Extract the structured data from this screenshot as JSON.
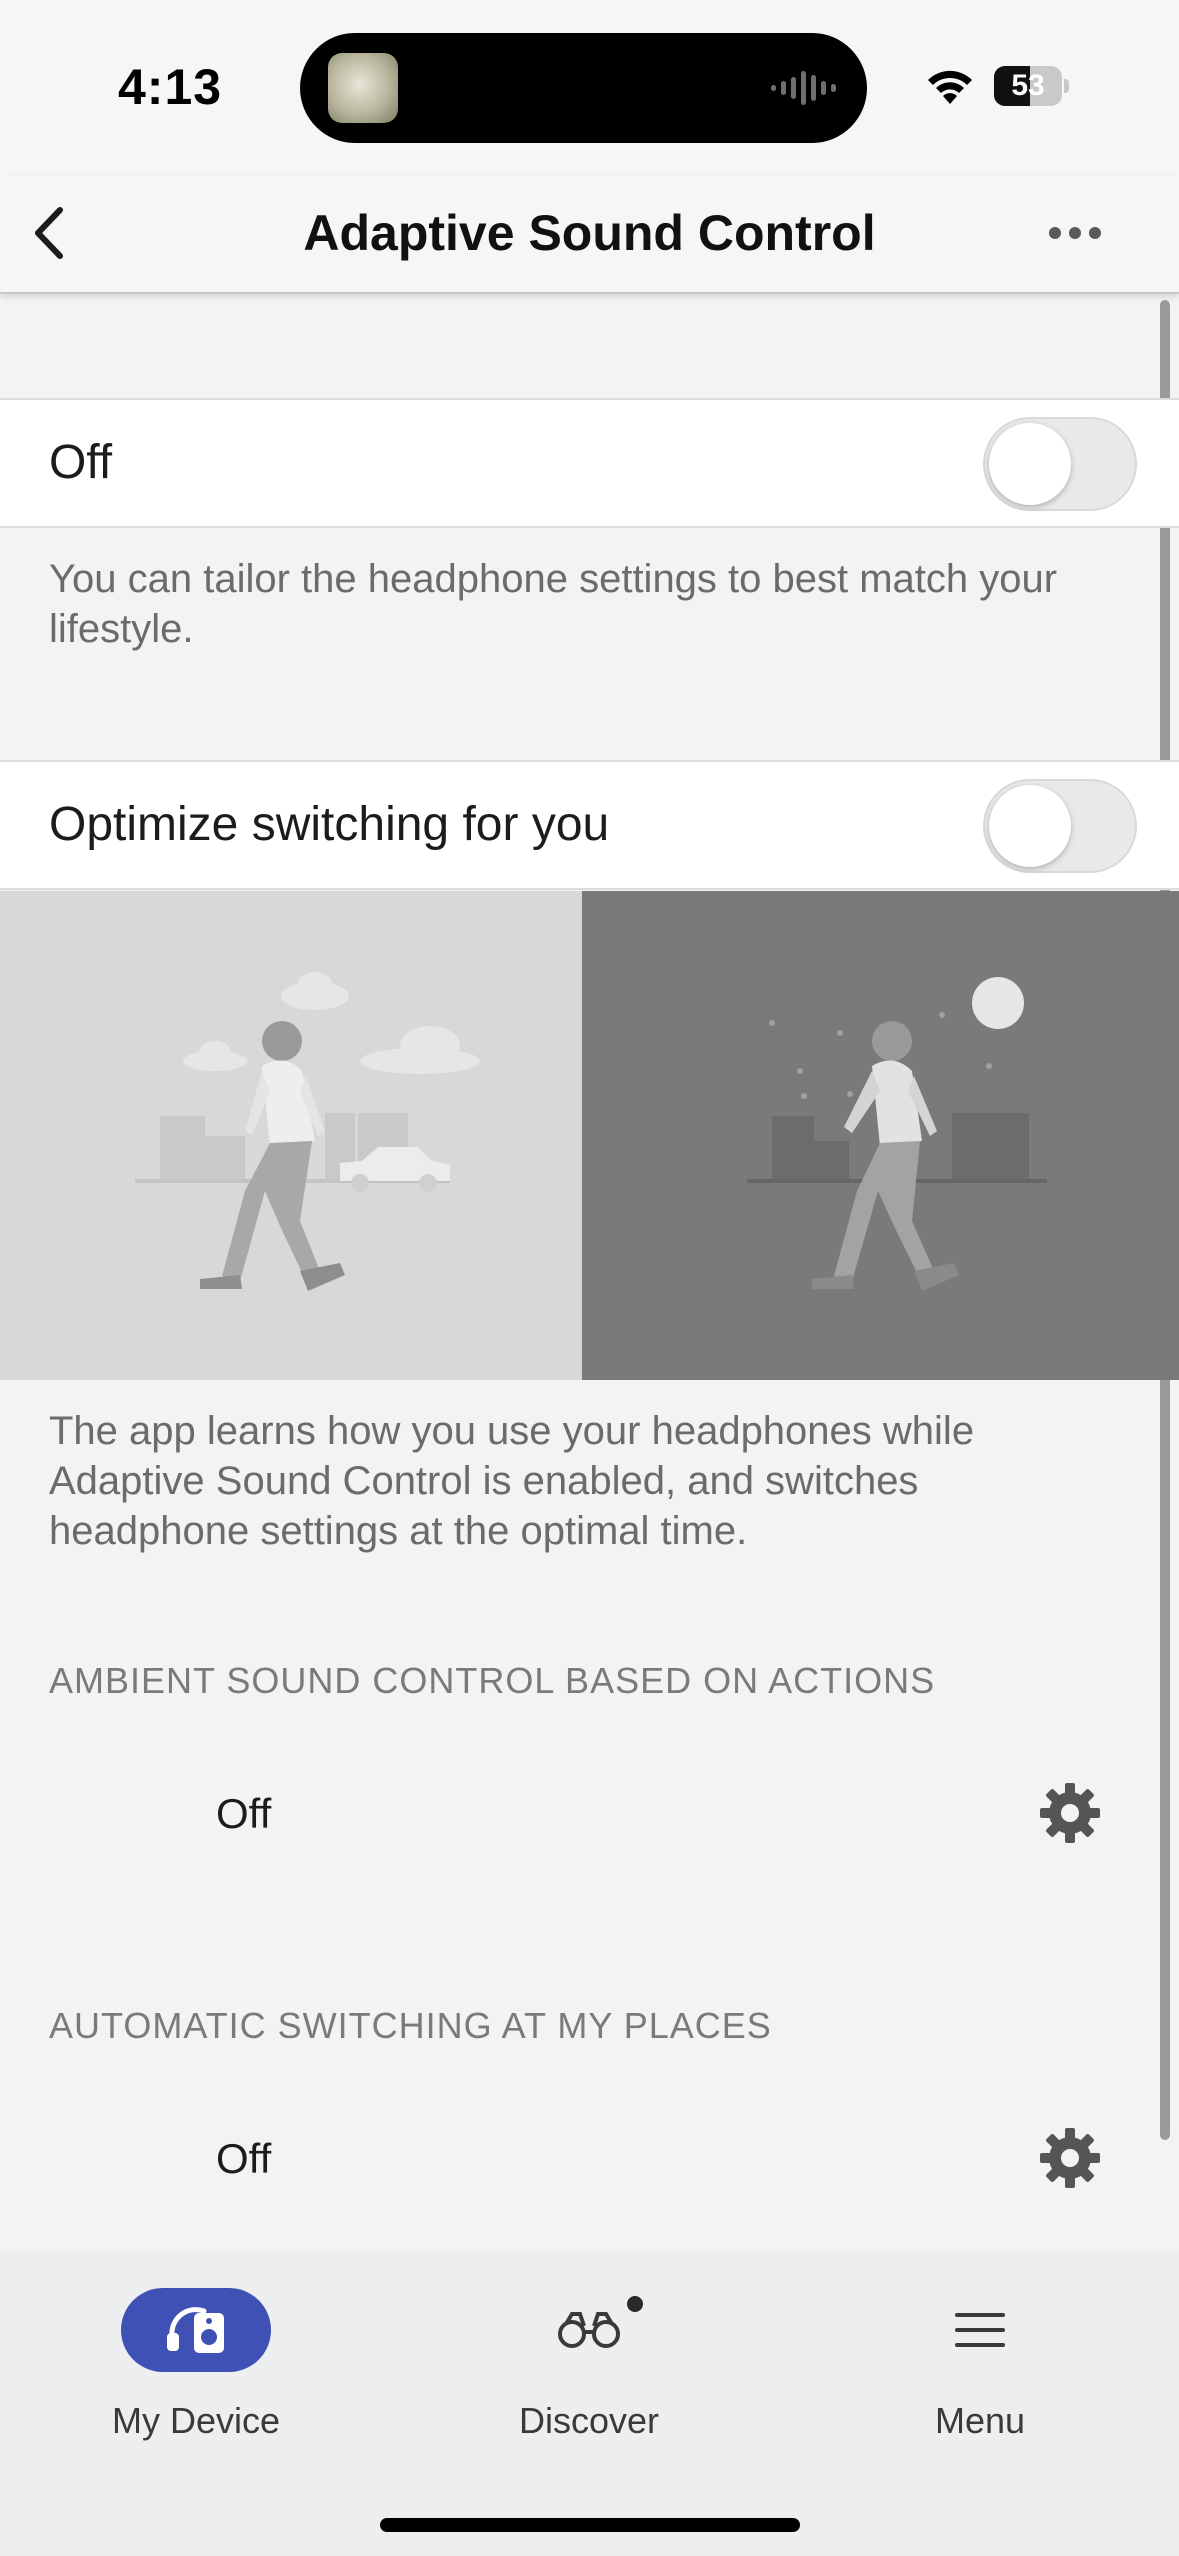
{
  "status_bar": {
    "time": "4:13",
    "battery_level": "53",
    "battery_fraction": 0.53
  },
  "nav": {
    "title": "Adaptive Sound Control",
    "back_icon": "chevron-left-icon",
    "more_icon": "ellipsis-icon"
  },
  "main_toggle": {
    "label": "Off",
    "state": false,
    "description": "You can tailor the headphone settings to best match your lifestyle."
  },
  "optimize_toggle": {
    "label": "Optimize switching for you",
    "state": false,
    "description": "The app learns how you use your headphones while Adaptive Sound Control is enabled, and switches headphone settings at the optimal time."
  },
  "sections": [
    {
      "header": "AMBIENT SOUND CONTROL BASED ON ACTIONS",
      "value": "Off",
      "icon": "gear-icon"
    },
    {
      "header": "AUTOMATIC SWITCHING AT MY PLACES",
      "value": "Off",
      "icon": "gear-icon"
    }
  ],
  "tabs": [
    {
      "label": "My Device",
      "icon": "headphones-speaker-icon",
      "active": true
    },
    {
      "label": "Discover",
      "icon": "binoculars-icon",
      "active": false,
      "badge": true
    },
    {
      "label": "Menu",
      "icon": "hamburger-icon",
      "active": false
    }
  ],
  "colors": {
    "accent": "#3f51b5",
    "background": "#f3f3f3",
    "illustration_day": "#d8d8d8",
    "illustration_night": "#7a7a7a"
  }
}
